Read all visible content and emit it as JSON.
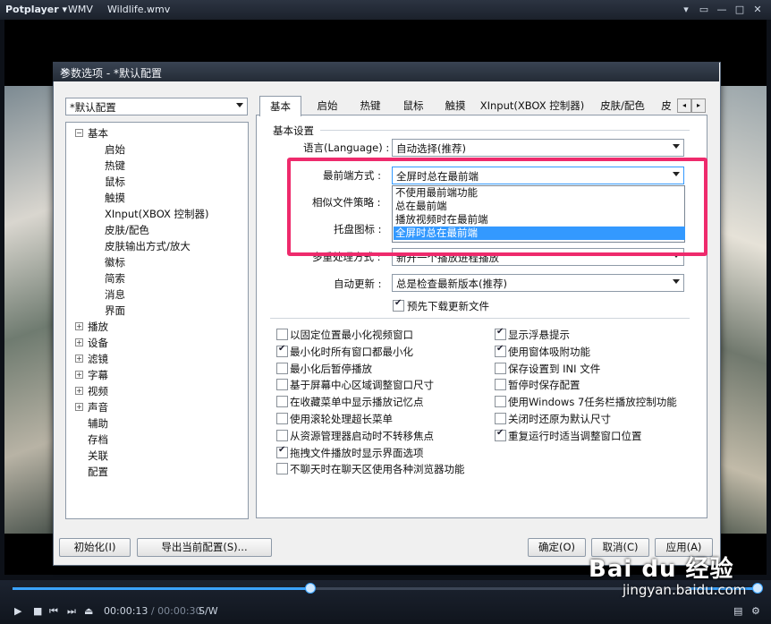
{
  "player": {
    "brand": "Potplayer ▾",
    "menu_wmv": "WMV",
    "file_name": "Wildlife.wmv",
    "window_buttons": [
      "▾",
      "▭",
      "—",
      "□",
      "✕"
    ],
    "time_current": "00:00:13",
    "time_sep": "/",
    "time_total": "00:00:30",
    "mode_label": "S/W",
    "seek_progress": 0.4,
    "volume_level": 1.0
  },
  "dialog": {
    "title": "参数选项 - *默认配置",
    "close": "✕",
    "profile_select": "*默认配置",
    "tree": [
      {
        "label": "基本",
        "level": 0,
        "exp": "−"
      },
      {
        "label": "启始",
        "level": 1
      },
      {
        "label": "热键",
        "level": 1
      },
      {
        "label": "鼠标",
        "level": 1
      },
      {
        "label": "触摸",
        "level": 1
      },
      {
        "label": "XInput(XBOX 控制器)",
        "level": 1
      },
      {
        "label": "皮肤/配色",
        "level": 1
      },
      {
        "label": "皮肤输出方式/放大",
        "level": 1
      },
      {
        "label": "徽标",
        "level": 1
      },
      {
        "label": "简索",
        "level": 1
      },
      {
        "label": "消息",
        "level": 1
      },
      {
        "label": "界面",
        "level": 1
      },
      {
        "label": "播放",
        "level": 0,
        "exp": "+"
      },
      {
        "label": "设备",
        "level": 0,
        "exp": "+"
      },
      {
        "label": "滤镜",
        "level": 0,
        "exp": "+"
      },
      {
        "label": "字幕",
        "level": 0,
        "exp": "+"
      },
      {
        "label": "视频",
        "level": 0,
        "exp": "+"
      },
      {
        "label": "声音",
        "level": 0,
        "exp": "+"
      },
      {
        "label": "辅助",
        "level": 0
      },
      {
        "label": "存档",
        "level": 0
      },
      {
        "label": "关联",
        "level": 0
      },
      {
        "label": "配置",
        "level": 0
      }
    ],
    "tabs": [
      "基本",
      "启始",
      "热键",
      "鼠标",
      "触摸",
      "XInput(XBOX 控制器)",
      "皮肤/配色",
      "皮肤"
    ],
    "tab_scroll_left": "◂",
    "tab_scroll_right": "▸",
    "group_title": "基本设置",
    "settings": {
      "language_label": "语言(Language) :",
      "language_value": "自动选择(推荐)",
      "topmost_label": "最前端方式 :",
      "topmost_value": "全屏时总在最前端",
      "similar_label": "相似文件策略 :",
      "tray_label": "托盘图标 :",
      "multi_label": "多重处理方式 :",
      "multi_value": "新开一个播放进程播放",
      "update_label": "自动更新 :",
      "update_value": "总是检查最新版本(推荐)",
      "predownload_label": "预先下载更新文件"
    },
    "dropdown_options": [
      "不使用最前端功能",
      "总在最前端",
      "播放视频时在最前端",
      "全屏时总在最前端"
    ],
    "checkboxes_left": [
      {
        "label": "以固定位置最小化视频窗口",
        "checked": false
      },
      {
        "label": "最小化时所有窗口都最小化",
        "checked": true
      },
      {
        "label": "最小化后暂停播放",
        "checked": false
      },
      {
        "label": "基于屏幕中心区域调整窗口尺寸",
        "checked": false
      },
      {
        "label": "在收藏菜单中显示播放记忆点",
        "checked": false
      },
      {
        "label": "使用滚轮处理超长菜单",
        "checked": false
      },
      {
        "label": "从资源管理器启动时不转移焦点",
        "checked": false
      },
      {
        "label": "拖拽文件播放时显示界面选项",
        "checked": true
      },
      {
        "label": "不聊天时在聊天区使用各种浏览器功能",
        "checked": false
      }
    ],
    "checkboxes_right": [
      {
        "label": "显示浮悬提示",
        "checked": true
      },
      {
        "label": "使用窗体吸附功能",
        "checked": true
      },
      {
        "label": "保存设置到 INI 文件",
        "checked": false
      },
      {
        "label": "暂停时保存配置",
        "checked": false
      },
      {
        "label": "使用Windows 7任务栏播放控制功能",
        "checked": false
      },
      {
        "label": "关闭时还原为默认尺寸",
        "checked": false
      },
      {
        "label": "重复运行时适当调整窗口位置",
        "checked": true
      }
    ],
    "buttons": {
      "init": "初始化(I)",
      "export": "导出当前配置(S)...",
      "ok": "确定(O)",
      "cancel": "取消(C)",
      "apply": "应用(A)"
    }
  },
  "watermark": {
    "text": "Bai du 经验",
    "url": "jingyan.baidu.com"
  },
  "colors": {
    "highlight": "#ee2a6c",
    "selection": "#3399ff",
    "accent": "#3ba3ff"
  }
}
